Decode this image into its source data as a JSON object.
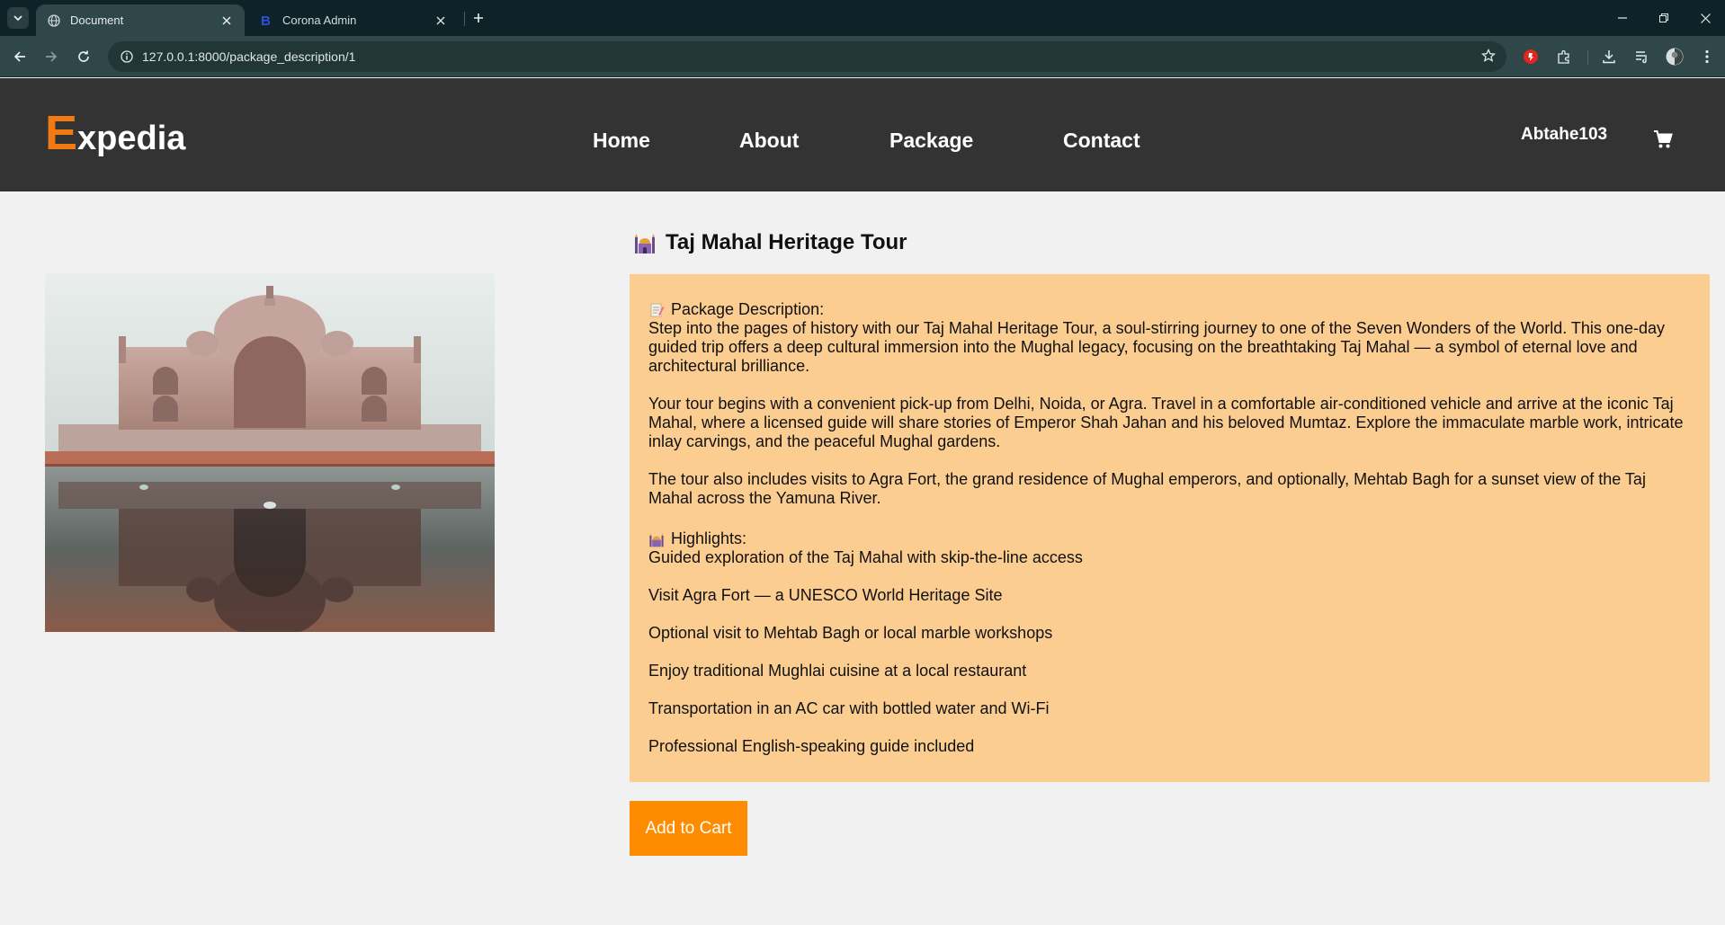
{
  "browser": {
    "tabs": [
      {
        "title": "Document",
        "active": true
      },
      {
        "title": "Corona Admin",
        "active": false
      }
    ],
    "url": "127.0.0.1:8000/package_description/1"
  },
  "header": {
    "logo_first": "E",
    "logo_rest": "xpedia",
    "nav": [
      "Home",
      "About",
      "Package",
      "Contact"
    ],
    "username": "Abtahe103"
  },
  "package": {
    "title": "Taj Mahal Heritage Tour",
    "description_heading": "Package Description:",
    "paragraphs": [
      "Step into the pages of history with our Taj Mahal Heritage Tour, a soul-stirring journey to one of the Seven Wonders of the World. This one-day guided trip offers a deep cultural immersion into the Mughal legacy, focusing on the breathtaking Taj Mahal — a symbol of eternal love and architectural brilliance.",
      "Your tour begins with a convenient pick-up from Delhi, Noida, or Agra. Travel in a comfortable air-conditioned vehicle and arrive at the iconic Taj Mahal, where a licensed guide will share stories of Emperor Shah Jahan and his beloved Mumtaz. Explore the immaculate marble work, intricate inlay carvings, and the peaceful Mughal gardens.",
      "The tour also includes visits to Agra Fort, the grand residence of Mughal emperors, and optionally, Mehtab Bagh for a sunset view of the Taj Mahal across the Yamuna River."
    ],
    "highlights_heading": "Highlights:",
    "highlights": [
      "Guided exploration of the Taj Mahal with skip-the-line access",
      "Visit Agra Fort — a UNESCO World Heritage Site",
      "Optional visit to Mehtab Bagh or local marble workshops",
      "Enjoy traditional Mughlai cuisine at a local restaurant",
      "Transportation in an AC car with bottled water and Wi-Fi",
      "Professional English-speaking guide included"
    ],
    "add_to_cart": "Add to Cart"
  },
  "colors": {
    "accent": "#ff8c00",
    "logo_accent": "#f27a12",
    "header_bg": "#333333",
    "description_bg": "#fbcd91"
  }
}
